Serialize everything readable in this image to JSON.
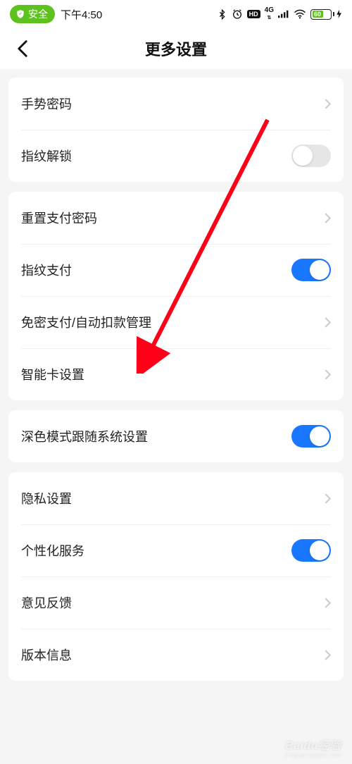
{
  "status": {
    "safe_label": "安全",
    "time": "下午4:50",
    "battery_pct": "60"
  },
  "header": {
    "title": "更多设置"
  },
  "groups": [
    {
      "rows": [
        {
          "key": "gesture-password",
          "label": "手势密码",
          "type": "nav"
        },
        {
          "key": "fingerprint-unlock",
          "label": "指纹解锁",
          "type": "toggle",
          "on": false
        }
      ]
    },
    {
      "rows": [
        {
          "key": "reset-pay-password",
          "label": "重置支付密码",
          "type": "nav"
        },
        {
          "key": "fingerprint-pay",
          "label": "指纹支付",
          "type": "toggle",
          "on": true
        },
        {
          "key": "autopay-manage",
          "label": "免密支付/自动扣款管理",
          "type": "nav"
        },
        {
          "key": "smartcard-settings",
          "label": "智能卡设置",
          "type": "nav"
        }
      ]
    },
    {
      "rows": [
        {
          "key": "dark-mode-follow",
          "label": "深色模式跟随系统设置",
          "type": "toggle",
          "on": true
        }
      ]
    },
    {
      "rows": [
        {
          "key": "privacy-settings",
          "label": "隐私设置",
          "type": "nav"
        },
        {
          "key": "personalization",
          "label": "个性化服务",
          "type": "toggle",
          "on": true
        },
        {
          "key": "feedback",
          "label": "意见反馈",
          "type": "nav"
        },
        {
          "key": "version-info",
          "label": "版本信息",
          "type": "nav"
        }
      ]
    }
  ],
  "watermark": {
    "brand": "Baidu经验",
    "url": "jingyan.baidu.com"
  }
}
